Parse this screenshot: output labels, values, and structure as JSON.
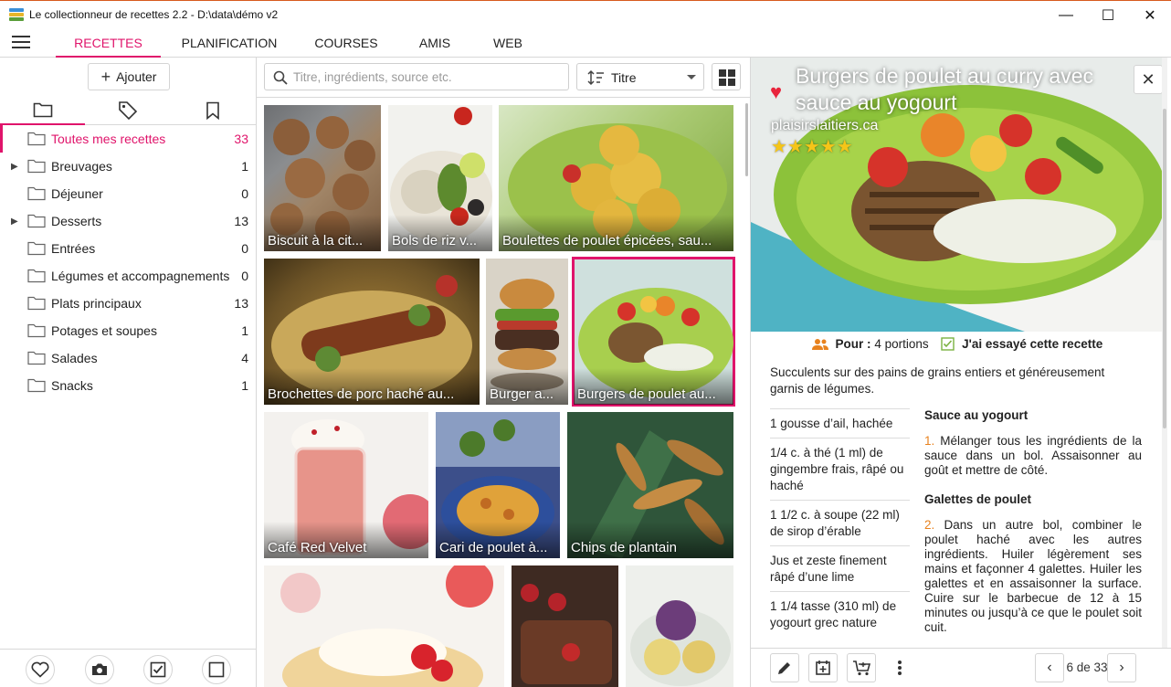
{
  "window": {
    "title": "Le collectionneur de recettes 2.2 - D:\\data\\démo v2",
    "minimize": "—",
    "maximize": "☐",
    "close": "✕"
  },
  "nav": {
    "tabs": [
      {
        "label": "RECETTES",
        "active": true
      },
      {
        "label": "PLANIFICATION",
        "active": false
      },
      {
        "label": "COURSES",
        "active": false
      },
      {
        "label": "AMIS",
        "active": false
      },
      {
        "label": "WEB",
        "active": false
      }
    ]
  },
  "sidebar": {
    "add_label": "Ajouter",
    "folders": [
      {
        "name": "Toutes mes recettes",
        "count": "33",
        "active": true,
        "expandable": false
      },
      {
        "name": "Breuvages",
        "count": "1",
        "active": false,
        "expandable": true
      },
      {
        "name": "Déjeuner",
        "count": "0",
        "active": false,
        "expandable": false
      },
      {
        "name": "Desserts",
        "count": "13",
        "active": false,
        "expandable": true
      },
      {
        "name": "Entrées",
        "count": "0",
        "active": false,
        "expandable": false
      },
      {
        "name": "Légumes et accompagnements",
        "count": "0",
        "active": false,
        "expandable": false
      },
      {
        "name": "Plats principaux",
        "count": "13",
        "active": false,
        "expandable": false
      },
      {
        "name": "Potages et soupes",
        "count": "1",
        "active": false,
        "expandable": false
      },
      {
        "name": "Salades",
        "count": "4",
        "active": false,
        "expandable": false
      },
      {
        "name": "Snacks",
        "count": "1",
        "active": false,
        "expandable": false
      }
    ]
  },
  "toolbar": {
    "search_placeholder": "Titre, ingrédients, source etc.",
    "sort_label": "Titre"
  },
  "recipes": [
    {
      "title": "Biscuit à la cit...",
      "selected": false
    },
    {
      "title": "Bols de riz v...",
      "selected": false
    },
    {
      "title": "Boulettes de poulet épicées, sau...",
      "selected": false
    },
    {
      "title": "Brochettes de porc haché au...",
      "selected": false
    },
    {
      "title": "Burger a...",
      "selected": false
    },
    {
      "title": "Burgers de poulet au...",
      "selected": true
    },
    {
      "title": "Café Red Velvet",
      "selected": false
    },
    {
      "title": "Cari de poulet à...",
      "selected": false
    },
    {
      "title": "Chips de plantain",
      "selected": false
    },
    {
      "title": "",
      "selected": false
    },
    {
      "title": "",
      "selected": false
    },
    {
      "title": "",
      "selected": false
    }
  ],
  "detail": {
    "title": "Burgers de poulet au curry avec sauce au yogourt",
    "source": "plaisirslaitiers.ca",
    "stars": "★★★★★",
    "rating": 5,
    "servings_label": "Pour :",
    "servings_value": "4 portions",
    "tried_label": "J'ai essayé cette recette",
    "description": "Succulents sur des pains de grains entiers et généreusement garnis de légumes.",
    "ingredients": [
      "1 gousse d’ail, hachée",
      "1/4 c. à thé (1 ml) de gingembre frais, râpé ou haché",
      "1 1/2 c. à soupe (22 ml) de sirop d’érable",
      "Jus et zeste finement râpé d’une lime",
      "1 1/4 tasse (310 ml) de yogourt grec nature"
    ],
    "sections": [
      {
        "heading": "Sauce au yogourt",
        "num": "1.",
        "text": "Mélanger tous les ingrédients de la sauce dans un bol. Assaisonner au goût et mettre de côté."
      },
      {
        "heading": "Galettes de poulet",
        "num": "2.",
        "text": "Dans un autre bol, combiner le poulet haché avec les autres ingrédients. Huiler légèrement ses mains et façonner 4 galettes. Huiler les galettes et en assaisonner la surface. Cuire sur le barbecue de 12 à 15 minutes ou jusqu’à ce que le poulet soit cuit."
      }
    ],
    "pager": "6 de 33"
  },
  "colors": {
    "accent": "#e0146b",
    "star": "#f5c518",
    "heart": "#e8243c",
    "step_number": "#e8821e"
  }
}
